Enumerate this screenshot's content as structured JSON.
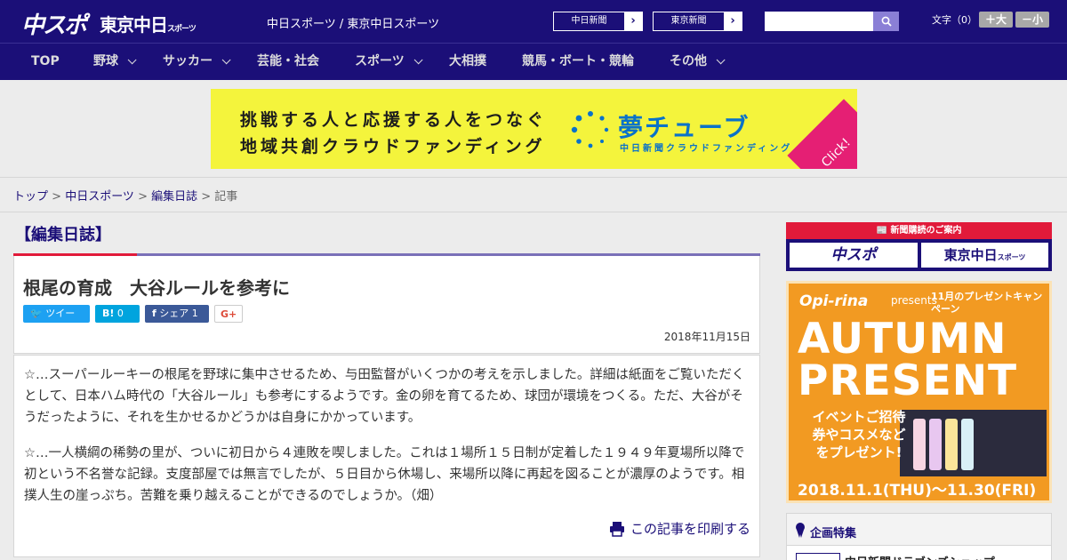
{
  "header": {
    "logo_main": "中スポ",
    "logo_tokyo": "東京中日",
    "logo_tokyo_small": "スポーツ",
    "site_links": "中日スポーツ / 東京中日スポーツ",
    "btn_chunichi": "中日新聞",
    "btn_tokyo": "東京新聞",
    "search_placeholder": "",
    "font_size_label": "文字（0）",
    "font_larger": "＋大",
    "font_smaller": "－小"
  },
  "nav": {
    "items": [
      "TOP",
      "野球",
      "サッカー",
      "芸能・社会",
      "スポーツ",
      "大相撲",
      "競馬・ボート・競輪",
      "その他"
    ]
  },
  "ad": {
    "line1": "挑戦する人と応援する人をつなぐ",
    "line2": "地域共創クラウドファンディング",
    "brand": "夢チューブ",
    "brand_sub": "中日新聞クラウドファンディング",
    "click": "Click!"
  },
  "breadcrumb": {
    "items": [
      "トップ",
      "中日スポーツ",
      "編集日誌"
    ],
    "current": "記事"
  },
  "article": {
    "section": "【編集日誌】",
    "title": "根尾の育成　大谷ルールを参考に",
    "share": {
      "tweet": "ツイート",
      "hatena": "0",
      "facebook": "シェア 1",
      "gplus": "G+"
    },
    "date": "2018年11月15日",
    "paragraphs": [
      "☆…スーパールーキーの根尾を野球に集中させるため、与田監督がいくつかの考えを示しました。詳細は紙面をご覧いただくとして、日本ハム時代の「大谷ルール」も参考にするようです。金の卵を育てるため、球団が環境をつくる。ただ、大谷がそうだったように、それを生かせるかどうかは自身にかかっています。",
      "☆…一人横綱の稀勢の里が、ついに初日から４連敗を喫しました。これは１場所１５日制が定着した１９４９年夏場所以降で初という不名誉な記録。支度部屋では無言でしたが、５日目から休場し、来場所以降に再起を図ることが濃厚のようです。相撲人生の崖っぷち。苦難を乗り越えることができるのでしょうか。（畑）"
    ],
    "print": "この記事を印刷する"
  },
  "sidebar": {
    "subscribe_head": "新聞購読のご案内",
    "subscribe_chuspo": "中スポ",
    "subscribe_tokyo": "東京中日",
    "subscribe_tokyo_small": "スポーツ",
    "autumn": {
      "brand": "Opi-rina",
      "presents": "presents",
      "campaign": "11月のプレゼントキャンペーン",
      "big1": "AUTUMN",
      "big2": "PRESENT",
      "promo": "イベントご招待券やコスメなどをプレゼント!",
      "dates": "2018.11.1(THU)～11.30(FRI)"
    },
    "kikaku_title": "企画特集",
    "kikaku_item": "中日新聞ドラゴンズショップ"
  },
  "colors": {
    "brand_navy": "#1b0f78",
    "accent_red": "#e11a3a",
    "twitter": "#1da1f2",
    "hatena": "#00a4de",
    "facebook": "#3b5998",
    "ad_yellow": "#f4f43c",
    "ad_blue": "#0a72c9",
    "autumn_orange": "#f29a22"
  }
}
